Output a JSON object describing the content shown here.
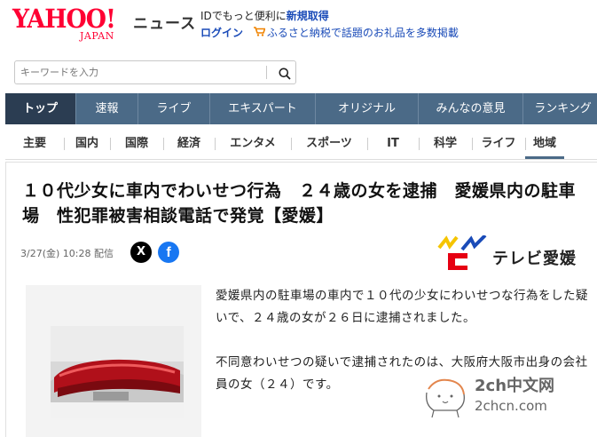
{
  "header": {
    "logo_main": "YAHOO!",
    "logo_sub": "JAPAN",
    "service_name": "ニュース",
    "promo_text": "IDでもっと便利に",
    "signup_link": "新規取得",
    "login_link": "ログイン",
    "furusato_link": "ふるさと納税で話題のお礼品を多数掲載"
  },
  "search": {
    "placeholder": "キーワードを入力"
  },
  "topnav": {
    "items": [
      {
        "label": "トップ"
      },
      {
        "label": "速報"
      },
      {
        "label": "ライブ"
      },
      {
        "label": "エキスパート"
      },
      {
        "label": "オリジナル"
      },
      {
        "label": "みんなの意見"
      },
      {
        "label": "ランキング"
      }
    ],
    "active": "トップ"
  },
  "subnav": {
    "items": [
      {
        "label": "主要"
      },
      {
        "label": "国内"
      },
      {
        "label": "国際"
      },
      {
        "label": "経済"
      },
      {
        "label": "エンタメ"
      },
      {
        "label": "スポーツ"
      },
      {
        "label": "IT"
      },
      {
        "label": "科学"
      },
      {
        "label": "ライフ"
      },
      {
        "label": "地域"
      }
    ],
    "active": "地域"
  },
  "article": {
    "headline": "１０代少女に車内でわいせつ行為　２４歳の女を逮捕　愛媛県内の駐車場　性犯罪被害相談電話で発覚【愛媛】",
    "meta": "3/27(金) 10:28 配信",
    "share_x": "X",
    "share_facebook": "f",
    "source_name": "テレビ愛媛",
    "paragraphs": [
      "愛媛県内の駐車場の車内で１０代の少女にわいせつな行為をした疑いで、２４歳の女が２６日に逮捕されました。",
      "不同意わいせつの疑いで逮捕されたのは、大阪府大阪市出身の会社員の女（２４）です。"
    ]
  },
  "watermark": {
    "site_name": "2ch中文网",
    "site_url": "2chcn.com"
  },
  "colors": {
    "yahoo_red": "#ff0033",
    "nav_bg": "#4b6a87",
    "nav_active": "#2b3d52",
    "link_blue": "#1a4bb8",
    "facebook_blue": "#1877f2"
  }
}
